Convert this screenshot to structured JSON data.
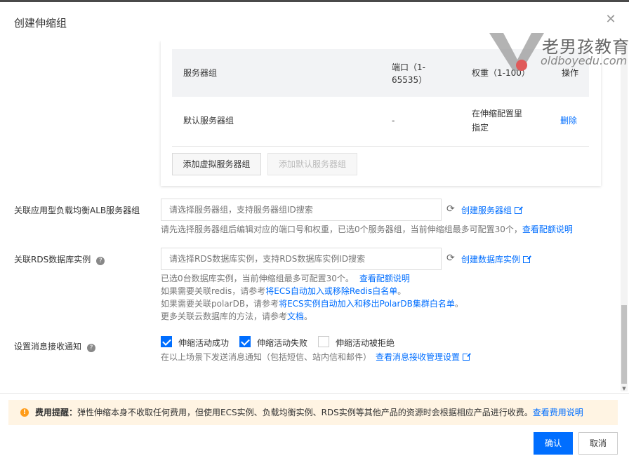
{
  "dialog": {
    "title": "创建伸缩组",
    "close_icon": "close-icon"
  },
  "watermark": {
    "brand": "老男孩教育",
    "site": "oldboyedu.com"
  },
  "server_table": {
    "headers": {
      "group": "服务器组",
      "port_line1": "端口（1-",
      "port_line2": "65535）",
      "weight": "权重（1-100）",
      "action": "操作"
    },
    "rows": [
      {
        "group": "默认服务器组",
        "port": "-",
        "weight_line1": "在伸缩配置里",
        "weight_line2": "指定",
        "action": "删除"
      }
    ],
    "add_virtual_button": "添加虚拟服务器组",
    "add_default_button": "添加默认服务器组"
  },
  "alb": {
    "label": "关联应用型负载均衡ALB服务器组",
    "placeholder": "请选择服务器组，支持服务器组ID搜索",
    "create_link": "创建服务器组",
    "hint": "请先选择服务器组后编辑对应的端口号和权重，已选0个服务器组，当前伸缩组最多可配置30个，",
    "hint_link": "查看配额说明"
  },
  "rds": {
    "label": "关联RDS数据库实例",
    "placeholder": "请选择RDS数据库实例，支持RDS数据库实例ID搜索",
    "create_link": "创建数据库实例",
    "hint1": "已选0台数据库实例，当前伸缩组最多可配置30个。",
    "hint1_link": "查看配额说明",
    "hint2": "如果需要关联redis，请参考",
    "hint2_link": "将ECS自动加入或移除Redis白名单",
    "hint2_end": "。",
    "hint3": "如果需要关联polarDB，请参考",
    "hint3_link": "将ECS实例自动加入和移出PolarDB集群白名单",
    "hint3_end": "。",
    "hint4": "更多关联云数据库的方法，请参考",
    "hint4_link": "文档",
    "hint4_end": "。"
  },
  "notify": {
    "label": "设置消息接收通知",
    "options": [
      {
        "label": "伸缩活动成功",
        "checked": true
      },
      {
        "label": "伸缩活动失败",
        "checked": true
      },
      {
        "label": "伸缩活动被拒绝",
        "checked": false
      }
    ],
    "hint": "在以上场景下发送消息通知（包括短信、站内信和邮件）",
    "hint_link": "查看消息接收管理设置"
  },
  "notice": {
    "prefix": "费用提醒：",
    "text": "弹性伸缩本身不收取任何费用，但使用ECS实例、负载均衡实例、RDS实例等其他产品的资源时会根据相应产品进行收费。",
    "link": "查看费用说明"
  },
  "footer": {
    "confirm": "确认",
    "cancel": "取消"
  },
  "colors": {
    "primary": "#006eff",
    "notice_bg": "#fff4e3",
    "warning": "#ff9c19"
  }
}
